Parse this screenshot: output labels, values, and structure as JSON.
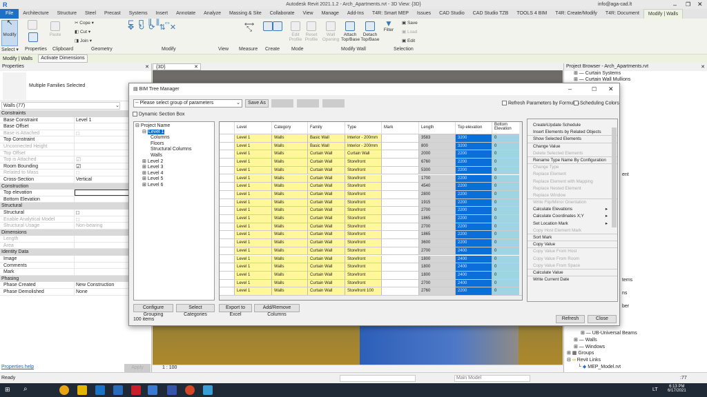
{
  "app": {
    "title": "Autodesk Revit 2021.1.2 - Arch_Apartments.rvt - 3D View: {3D}",
    "user": "info@aga-cad.lt"
  },
  "tabs": [
    "File",
    "Architecture",
    "Structure",
    "Steel",
    "Precast",
    "Systems",
    "Insert",
    "Annotate",
    "Analyze",
    "Massing & Site",
    "Collaborate",
    "View",
    "Manage",
    "Add-Ins",
    "T4R: Smart MEP",
    "Issues",
    "CAD Studio",
    "CAD Studio TZB",
    "TOOLS 4 BIM",
    "T4R: Create/Modify",
    "T4R: Document",
    "Modify | Walls"
  ],
  "ribbon": {
    "panels": [
      "Select ▾",
      "Properties",
      "Clipboard",
      "Geometry",
      "Modify",
      "View",
      "Measure",
      "Create",
      "Mode",
      "Modify Wall",
      "Selection"
    ],
    "tools": {
      "modify": "Modify",
      "paste": "Paste",
      "cope": "Cope",
      "cut": "Cut",
      "join": "Join",
      "edit_profile": "Edit Profile",
      "reset_profile": "Reset Profile",
      "wall_opening": "Wall Opening",
      "attach": "Attach Top/Base",
      "detach": "Detach Top/Base",
      "filter": "Filter",
      "save": "Save",
      "load": "Load",
      "edit": "Edit"
    }
  },
  "context_bar": {
    "label": "Modify | Walls",
    "button": "Activate Dimensions"
  },
  "properties": {
    "title": "Properties",
    "type_label": "Multiple Families Selected",
    "selector": "Walls (77)",
    "help": "Properties help",
    "apply": "Apply",
    "groups": [
      {
        "name": "Constraints",
        "rows": [
          [
            "Base Constraint",
            "Level 1",
            0
          ],
          [
            "Base Offset",
            "",
            0
          ],
          [
            "Base is Attached",
            "□",
            1
          ],
          [
            "Top Constraint",
            "",
            0
          ],
          [
            "Unconnected Height",
            "",
            1
          ],
          [
            "Top Offset",
            "",
            1
          ],
          [
            "Top is Attached",
            "☑",
            1
          ],
          [
            "Room Bounding",
            "☑",
            0
          ],
          [
            "Related to Mass",
            "□",
            1
          ],
          [
            "Cross-Section",
            "Vertical",
            0
          ]
        ]
      },
      {
        "name": "Construction",
        "rows": [
          [
            "Top elevation",
            "",
            0
          ],
          [
            "Bottom Elevation",
            "",
            0
          ]
        ]
      },
      {
        "name": "Structural",
        "rows": [
          [
            "Structural",
            "□",
            0
          ],
          [
            "Enable Analytical Model",
            "□",
            1
          ],
          [
            "Structural Usage",
            "Non-bearing",
            1
          ]
        ]
      },
      {
        "name": "Dimensions",
        "rows": [
          [
            "Length",
            "",
            1
          ],
          [
            "Area",
            "",
            1
          ]
        ]
      },
      {
        "name": "Identity Data",
        "rows": [
          [
            "Image",
            "",
            0
          ],
          [
            "Comments",
            "",
            0
          ],
          [
            "Mark",
            "",
            0
          ]
        ]
      },
      {
        "name": "Phasing",
        "rows": [
          [
            "Phase Created",
            "New Construction",
            0
          ],
          [
            "Phase Demolished",
            "None",
            0
          ]
        ]
      }
    ]
  },
  "view": {
    "tab": "{3D}",
    "scale": "1 : 100"
  },
  "browser": {
    "title": "Project Browser - Arch_Apartments.rvt",
    "items": [
      "Curtain Systems",
      "Curtain Wall Mullions"
    ],
    "partial": [
      "ent",
      "tems",
      "ns",
      "ber"
    ],
    "bottom": [
      "UB-Universal Beams",
      "Walls",
      "Windows",
      "Groups",
      "Revit Links",
      "MEP_Model.rvt"
    ]
  },
  "dialog": {
    "title": "BIM Tree Manager",
    "param_group": "-- Please select group of parameters",
    "save_as": "Save As",
    "save": "Save",
    "rename": "Rename",
    "delete": "Delete",
    "refresh_formulas": "Refresh Parameters by Formulas",
    "scheduling_colors": "Scheduling Colors",
    "dynamic_section": "Dynamic Section Box",
    "tree": {
      "root": "Project Name",
      "level1": "Level 1",
      "children": [
        "Columns",
        "Floors",
        "Structural Columns",
        "Walls"
      ],
      "levels": [
        "Level 2",
        "Level 3",
        "Level 4",
        "Level 5",
        "Level 6"
      ]
    },
    "columns": [
      "Level",
      "Category",
      "Family",
      "Type",
      "Mark",
      "Length",
      "Top elevation",
      "Bottom Elevation"
    ],
    "rows": [
      [
        "Level 1",
        "Walls",
        "Basic Wall",
        "Interior - 200mm",
        "",
        "3583",
        "3200",
        "0"
      ],
      [
        "Level 1",
        "Walls",
        "Basic Wall",
        "Interior - 200mm",
        "",
        "800",
        "3200",
        "0"
      ],
      [
        "Level 1",
        "Walls",
        "Curtain Wall",
        "Curtain Wall",
        "",
        "2000",
        "2200",
        "0"
      ],
      [
        "Level 1",
        "Walls",
        "Curtain Wall",
        "Storefront",
        "",
        "6760",
        "2200",
        "0"
      ],
      [
        "Level 1",
        "Walls",
        "Curtain Wall",
        "Storefront",
        "",
        "5300",
        "2200",
        "0"
      ],
      [
        "Level 1",
        "Walls",
        "Curtain Wall",
        "Storefront",
        "",
        "1700",
        "2200",
        "0"
      ],
      [
        "Level 1",
        "Walls",
        "Curtain Wall",
        "Storefront",
        "",
        "4540",
        "2200",
        "0"
      ],
      [
        "Level 1",
        "Walls",
        "Curtain Wall",
        "Storefront",
        "",
        "2800",
        "2200",
        "0"
      ],
      [
        "Level 1",
        "Walls",
        "Curtain Wall",
        "Storefront",
        "",
        "1915",
        "2200",
        "0"
      ],
      [
        "Level 1",
        "Walls",
        "Curtain Wall",
        "Storefront",
        "",
        "2700",
        "2200",
        "0"
      ],
      [
        "Level 1",
        "Walls",
        "Curtain Wall",
        "Storefront",
        "",
        "1865",
        "2200",
        "0"
      ],
      [
        "Level 1",
        "Walls",
        "Curtain Wall",
        "Storefront",
        "",
        "2700",
        "2200",
        "0"
      ],
      [
        "Level 1",
        "Walls",
        "Curtain Wall",
        "Storefront",
        "",
        "1865",
        "2200",
        "0"
      ],
      [
        "Level 1",
        "Walls",
        "Curtain Wall",
        "Storefront",
        "",
        "3600",
        "2200",
        "0"
      ],
      [
        "Level 1",
        "Walls",
        "Curtain Wall",
        "Storefront",
        "",
        "2700",
        "2400",
        "0"
      ],
      [
        "Level 1",
        "Walls",
        "Curtain Wall",
        "Storefront",
        "",
        "1800",
        "2400",
        "0"
      ],
      [
        "Level 1",
        "Walls",
        "Curtain Wall",
        "Storefront",
        "",
        "1800",
        "2400",
        "0"
      ],
      [
        "Level 1",
        "Walls",
        "Curtain Wall",
        "Storefront",
        "",
        "1800",
        "2400",
        "0"
      ],
      [
        "Level 1",
        "Walls",
        "Curtain Wall",
        "Storefront",
        "",
        "2700",
        "2400",
        "0"
      ],
      [
        "Level 1",
        "Walls",
        "Curtain Wall",
        "Storefront 100",
        "",
        "2760",
        "2200",
        "0"
      ]
    ],
    "menu": [
      [
        "Create\\Update Schedule",
        0,
        0,
        0
      ],
      [
        "Insert Elements by Related Objects",
        0,
        1,
        0
      ],
      [
        "Show Selected Elements",
        0,
        1,
        0
      ],
      [
        "Change Value",
        0,
        0,
        0
      ],
      [
        "Delete Selected Elements",
        1,
        1,
        0
      ],
      [
        "Rename Type Name By Configuration",
        0,
        1,
        0
      ],
      [
        "Change Type",
        1,
        0,
        0
      ],
      [
        "Replace Element",
        1,
        0,
        0
      ],
      [
        "Replace Element with Mapping",
        1,
        0,
        0
      ],
      [
        "Replace Nested Element",
        1,
        0,
        0
      ],
      [
        "Replace Window",
        1,
        1,
        0
      ],
      [
        "Write Flip/Mirror Orientation",
        1,
        0,
        0
      ],
      [
        "Calculate Elevations",
        0,
        0,
        1
      ],
      [
        "Calculate Coordinates X;Y",
        0,
        0,
        1
      ],
      [
        "Set Location Mark",
        0,
        0,
        1
      ],
      [
        "Copy Host Element Mark",
        1,
        1,
        0
      ],
      [
        "Sort Mark",
        0,
        1,
        0
      ],
      [
        "Copy Value",
        0,
        1,
        0
      ],
      [
        "Copy Value From Host",
        1,
        0,
        0
      ],
      [
        "Copy Value From Room",
        1,
        0,
        0
      ],
      [
        "Copy Value From Space",
        1,
        1,
        0
      ],
      [
        "Calculate Value",
        0,
        1,
        0
      ],
      [
        "Write Current Date",
        0,
        0,
        0
      ]
    ],
    "configure_grouping": "Configure Grouping",
    "select_categories": "Select Categories",
    "export_excel": "Export to Excel",
    "add_remove_columns": "Add/Remove Columns",
    "count": "100 items",
    "refresh": "Refresh",
    "close": "Close"
  },
  "status": {
    "text": "Ready",
    "model": "Main Model",
    "filter_count": ":77"
  },
  "taskbar": {
    "time": "6:13 PM",
    "date": "6/17/2021",
    "lang": "LT"
  },
  "colors": {
    "accent": "#1e6fc6",
    "yellow": "#fff799",
    "selected": "#0a6fd8",
    "light_blue": "#9fd4e2",
    "gray_cell": "#d4d4d4"
  }
}
